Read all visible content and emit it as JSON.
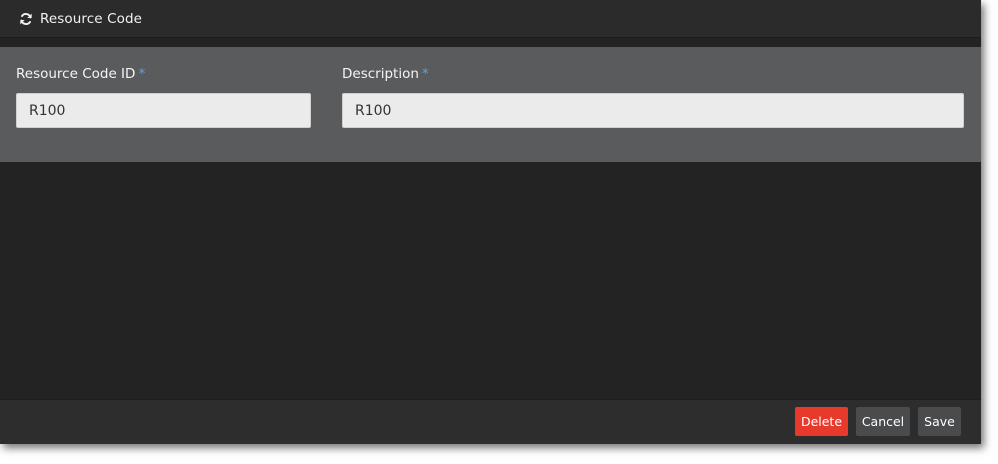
{
  "window": {
    "title": "Resource Code",
    "title_icon": "refresh-icon"
  },
  "form": {
    "resource_code_id": {
      "label": "Resource Code ID",
      "required_marker": "*",
      "value": "R100"
    },
    "description": {
      "label": "Description",
      "required_marker": "*",
      "value": "R100"
    }
  },
  "footer": {
    "delete_label": "Delete",
    "cancel_label": "Cancel",
    "save_label": "Save"
  },
  "colors": {
    "accent_required": "#5aa2e6",
    "delete_button": "#e8392d",
    "secondary_button": "#4a4b4d",
    "panel_background": "#5a5b5d",
    "window_background": "#232323"
  }
}
